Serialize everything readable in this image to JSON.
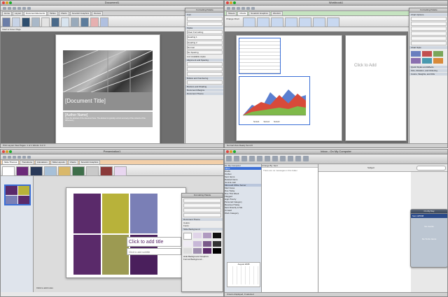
{
  "word": {
    "title": "Document1",
    "tabs": [
      "Home",
      "Layout",
      "Document Elements",
      "Tables",
      "Charts",
      "SmartArt Graphics",
      "Review"
    ],
    "cover_label": "Insert a Cover Page",
    "doc_title": "[Document Title]",
    "author": "[Author Name]",
    "abstract": "[Type the abstract of the document here. The abstract is typically a short summary of the contents of the document.]",
    "palette_title": "Formatting Palette",
    "palette_sections": [
      "Font",
      "Styles",
      "Alignment and Spacing",
      "Bullets and Numbering",
      "Borders and Shading",
      "Document Margins",
      "Document Theme"
    ],
    "styles": [
      "Clear Formatting",
      "Heading 1",
      "Heading 2",
      "Normal",
      "No Spacing",
      "List: Available styles"
    ],
    "status": [
      "Print Layout View",
      "Sec",
      "Pages:",
      "1 of 1",
      "Words:",
      "0 of 0"
    ]
  },
  "excel": {
    "title": "Workbook1",
    "tabs": [
      "Sheets",
      "Charts",
      "SmartArt Graphics",
      "WordArt"
    ],
    "chart_type_label": "Change Chart",
    "click_to_add": "Click to Add",
    "palette_title": "Formatting Palette",
    "palette_sections": [
      "Chart Options",
      "Chart Style",
      "Quick Styles and Effects",
      "Size, Rotation, and Ordering",
      "Colors, Weights, and Fills"
    ],
    "series_labels": [
      "Series1",
      "Series2",
      "Series3"
    ],
    "status": [
      "Normal View",
      "Ready",
      "Sum=0"
    ],
    "sheet_tab": "Sheet1"
  },
  "ppt": {
    "title": "Presentation1",
    "tabs": [
      "Slide Themes",
      "Transitions",
      "Animations",
      "Slide Layouts",
      "Charts",
      "SmartArt Graphics"
    ],
    "click_title": "Click to add title",
    "click_subtitle": "Click to add subtitle",
    "notes": "Click to add notes",
    "palette_title": "Formatting Palette",
    "palette_sections": [
      "Slide Background",
      "Document Theme"
    ],
    "bg_options": [
      "Hide Background Graphics",
      "Format Background..."
    ],
    "colors_label": "Colors:",
    "fonts_label": "Fonts:",
    "swatch_colors": [
      "#5a2a6a",
      "#b8b23a",
      "#7a7fb6",
      "#d0cfd8"
    ]
  },
  "outlook": {
    "title": "Inbox - On My Computer",
    "toolbar": [
      "New",
      "Delete",
      "Reply",
      "Reply All",
      "Forward",
      "Send/Receive",
      "Categorize",
      "Junk",
      "Rules",
      "Sync",
      "Mailing",
      "My Day"
    ],
    "folders": [
      "On My Computer",
      "Inbox",
      "Drafts",
      "Outbox",
      "Sent Items",
      "Deleted Items",
      "Junk E-mail",
      "Microsoft Office Server",
      "Mail Views",
      "Due Today",
      "Due This Week",
      "Flagged",
      "High Priority",
      "Personal Category",
      "Received Today",
      "Sent Directly to Me",
      "Unread",
      "Work Category"
    ],
    "list_header": "Arrange By: Sent",
    "list_empty": "There are no messages in this folder",
    "search_label": "Subject",
    "month": "August 2008",
    "status": "0 items displayed, 0 selected",
    "myday_header": "On My Day",
    "myday_date": "Sun 10/5/08",
    "myday_empty": "No events",
    "myday_footer": "No To Do Items"
  }
}
